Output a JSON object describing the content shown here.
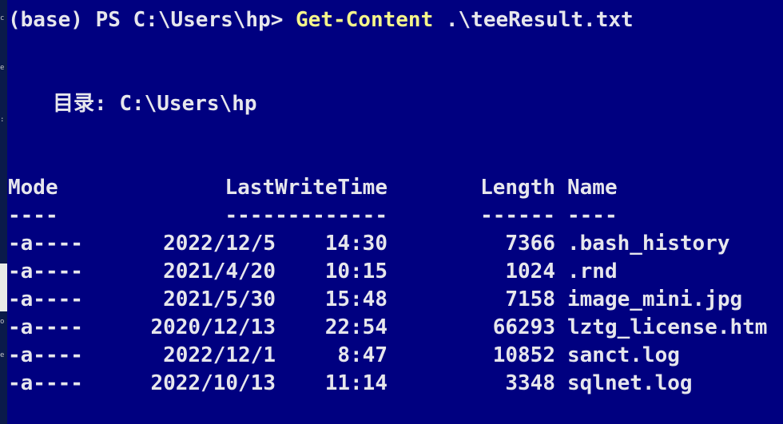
{
  "prompt": {
    "text": "(base) PS C:\\Users\\hp> ",
    "command": "Get-Content",
    "argument": ".\\teeResult.txt"
  },
  "directory": {
    "label": "目录:",
    "path": "C:\\Users\\hp"
  },
  "table": {
    "headers": {
      "mode": "Mode",
      "lastwritetime": "LastWriteTime",
      "length": "Length",
      "name": "Name"
    },
    "underlines": {
      "mode": "----",
      "lastwritetime": "-------------",
      "length": "------",
      "name": "----"
    },
    "rows": [
      {
        "mode": "-a----",
        "date": "2022/12/5",
        "time": "14:30",
        "length": "7366",
        "name": ".bash_history"
      },
      {
        "mode": "-a----",
        "date": "2021/4/20",
        "time": "10:15",
        "length": "1024",
        "name": ".rnd"
      },
      {
        "mode": "-a----",
        "date": "2021/5/30",
        "time": "15:48",
        "length": "7158",
        "name": "image_mini.jpg"
      },
      {
        "mode": "-a----",
        "date": "2020/12/13",
        "time": "22:54",
        "length": "66293",
        "name": "lztg_license.htm"
      },
      {
        "mode": "-a----",
        "date": "2022/12/1",
        "time": "8:47",
        "length": "10852",
        "name": "sanct.log"
      },
      {
        "mode": "-a----",
        "date": "2022/10/13",
        "time": "11:14",
        "length": "3348",
        "name": "sqlnet.log"
      }
    ]
  },
  "colors": {
    "background": "#000080",
    "text": "#e6e6ec",
    "command": "#f5f58a"
  }
}
